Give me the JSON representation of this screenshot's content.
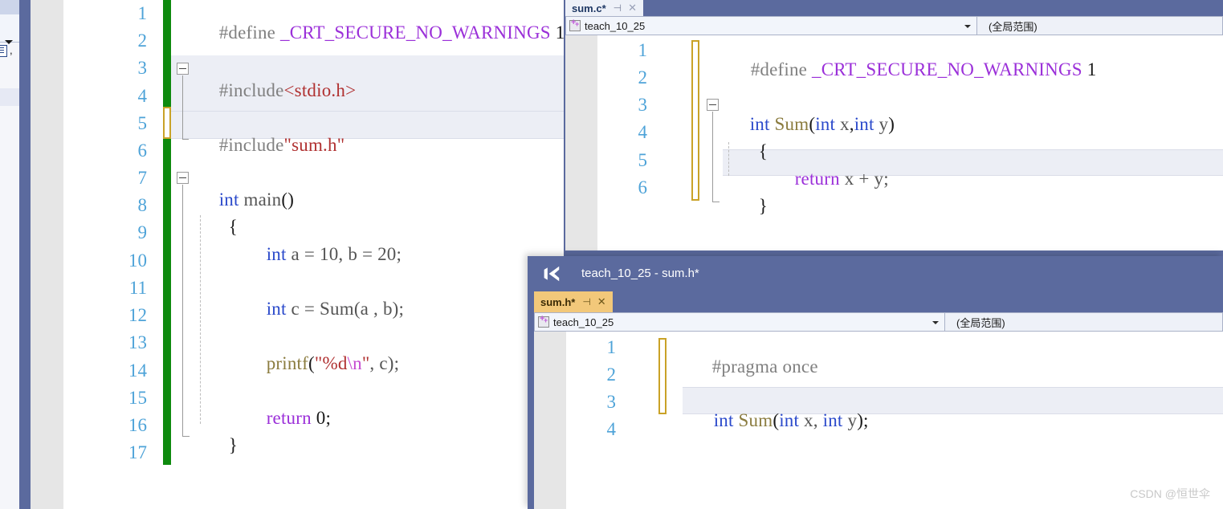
{
  "app": {
    "name": "Visual Studio",
    "watermark": "CSDN @恒世伞"
  },
  "left_sliver": {
    "comma_glyph": ",",
    "dropdown_icon": "chevron-down-icon"
  },
  "main_editor": {
    "line_numbers": [
      "1",
      "2",
      "3",
      "4",
      "5",
      "6",
      "7",
      "8",
      "9",
      "10",
      "11",
      "12",
      "13",
      "14",
      "15",
      "16",
      "17"
    ],
    "lines": [
      {
        "n": "1",
        "text": "#define _CRT_SECURE_NO_WARNINGS 1"
      },
      {
        "n": "2",
        "text": ""
      },
      {
        "n": "3",
        "text": "#include<stdio.h>"
      },
      {
        "n": "4",
        "text": ""
      },
      {
        "n": "5",
        "text": "#include\"sum.h\""
      },
      {
        "n": "6",
        "text": ""
      },
      {
        "n": "7",
        "text": "int main()"
      },
      {
        "n": "8",
        "text": "{"
      },
      {
        "n": "9",
        "text": "    int a = 10, b = 20;"
      },
      {
        "n": "10",
        "text": ""
      },
      {
        "n": "11",
        "text": "    int c = Sum(a , b);"
      },
      {
        "n": "12",
        "text": ""
      },
      {
        "n": "13",
        "text": "    printf(\"%d\\n\", c);"
      },
      {
        "n": "14",
        "text": ""
      },
      {
        "n": "15",
        "text": "    return 0;"
      },
      {
        "n": "16",
        "text": "}"
      },
      {
        "n": "17",
        "text": ""
      }
    ],
    "tokens": {
      "l1_define": "#define ",
      "l1_macro": "_CRT_SECURE_NO_WARNINGS",
      "l1_one": " 1",
      "l3_include": "#include",
      "l3_path": "<stdio.h>",
      "l5_include": "#include",
      "l5_path": "\"sum.h\"",
      "l7_int": "int",
      "l7_main": " main",
      "l7_parens": "()",
      "l8_brace": "{",
      "l9_int": "int",
      "l9_rest": " a = 10, b = 20;",
      "l11_int": "int",
      "l11_c": " c = ",
      "l11_sum": "Sum",
      "l11_args": "(a , b);",
      "l13_printf": "printf",
      "l13_open": "(",
      "l13_str1": "\"%d",
      "l13_esc": "\\n",
      "l13_str2": "\"",
      "l13_tail": ", c);",
      "l15_return": "return",
      "l15_zero": " 0;",
      "l16_brace": "}"
    }
  },
  "sumc_window": {
    "tab": {
      "label": "sum.c*",
      "pin_icon": "pin-icon",
      "close_icon": "close-icon"
    },
    "toolbar": {
      "project_combo_value": "teach_10_25",
      "project_combo_icon": "project-icon",
      "dropdown_icon": "chevron-down-icon",
      "scope_combo_value": "(全局范围)"
    },
    "line_numbers": [
      "1",
      "2",
      "3",
      "4",
      "5",
      "6"
    ],
    "lines": [
      {
        "n": "1",
        "text": "#define _CRT_SECURE_NO_WARNINGS 1"
      },
      {
        "n": "2",
        "text": ""
      },
      {
        "n": "3",
        "text": "int Sum(int x,int y)"
      },
      {
        "n": "4",
        "text": "{"
      },
      {
        "n": "5",
        "text": "    return x + y;"
      },
      {
        "n": "6",
        "text": "}"
      }
    ],
    "tokens": {
      "l1_define": "#define ",
      "l1_macro": "_CRT_SECURE_NO_WARNINGS",
      "l1_one": " 1",
      "l3_int": "int",
      "l3_sum": " Sum",
      "l3_open": "(",
      "l3_intx": "int",
      "l3_x": " x",
      "l3_comma": ",",
      "l3_inty": "int",
      "l3_y": " y",
      "l3_close": ")",
      "l4_brace": "{",
      "l5_return": "return",
      "l5_expr": " x + y;",
      "l6_brace": "}"
    }
  },
  "sumh_window": {
    "title": "teach_10_25 - sum.h*",
    "logo_icon": "visual-studio-logo-icon",
    "tab": {
      "label": "sum.h*",
      "pin_icon": "pin-icon",
      "close_icon": "close-icon"
    },
    "toolbar": {
      "project_combo_value": "teach_10_25",
      "project_combo_icon": "project-icon",
      "dropdown_icon": "chevron-down-icon",
      "scope_combo_value": "(全局范围)"
    },
    "line_numbers": [
      "1",
      "2",
      "3",
      "4"
    ],
    "lines": [
      {
        "n": "1",
        "text": "#pragma once"
      },
      {
        "n": "2",
        "text": ""
      },
      {
        "n": "3",
        "text": "int Sum(int x, int y);"
      },
      {
        "n": "4",
        "text": ""
      }
    ],
    "tokens": {
      "l1_pragma": "#pragma once",
      "l3_int": "int",
      "l3_sum": " Sum",
      "l3_open": "(",
      "l3_intx": "int",
      "l3_x": " x,",
      "l3_inty": " int",
      "l3_y": " y",
      "l3_close": ");"
    }
  },
  "colors": {
    "chrome_blue": "#5b6a9e",
    "tab_active_h": "#f2c87a",
    "changebar_green": "#0e8a0e",
    "changebar_gold": "#c9a227",
    "linenum": "#4ea3d8",
    "macro_purple": "#9b30d9",
    "keyword_blue": "#2b4acb",
    "string_red": "#b03030"
  }
}
